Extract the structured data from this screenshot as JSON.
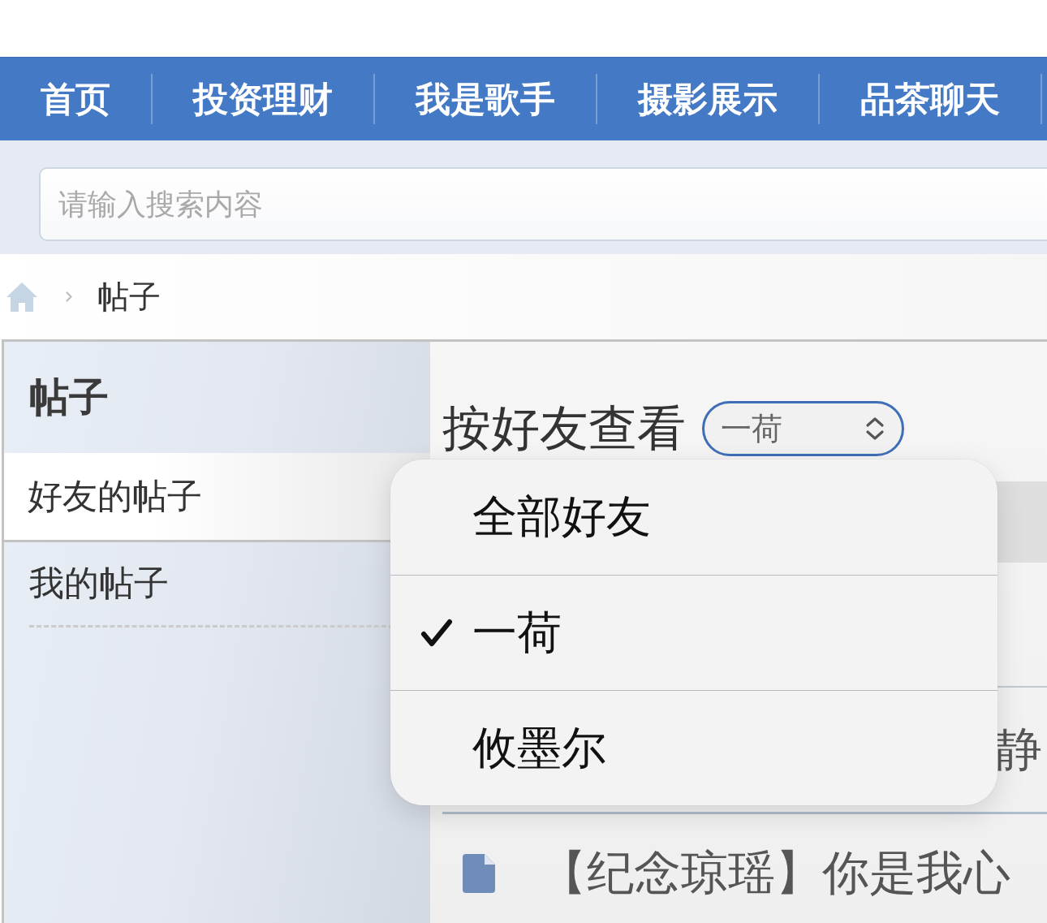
{
  "nav": {
    "items": [
      {
        "label": "首页"
      },
      {
        "label": "投资理财"
      },
      {
        "label": "我是歌手"
      },
      {
        "label": "摄影展示"
      },
      {
        "label": "品茶聊天"
      }
    ]
  },
  "search": {
    "placeholder": "请输入搜索内容"
  },
  "breadcrumb": {
    "current": "帖子"
  },
  "sidebar": {
    "title": "帖子",
    "items": [
      {
        "label": "好友的帖子",
        "selected": true
      },
      {
        "label": "我的帖子",
        "selected": false
      }
    ]
  },
  "main": {
    "filter_label": "按好友查看",
    "friend_select": {
      "value": "一荷",
      "expanded": true,
      "options": [
        {
          "label": "全部好友",
          "selected": false
        },
        {
          "label": "一荷",
          "selected": true
        },
        {
          "label": "攸墨尔",
          "selected": false
        }
      ]
    },
    "posts": [
      {
        "kind": "covered",
        "title": "静"
      },
      {
        "kind": "post",
        "title": "【纪念琼瑶】你是我心"
      }
    ]
  }
}
